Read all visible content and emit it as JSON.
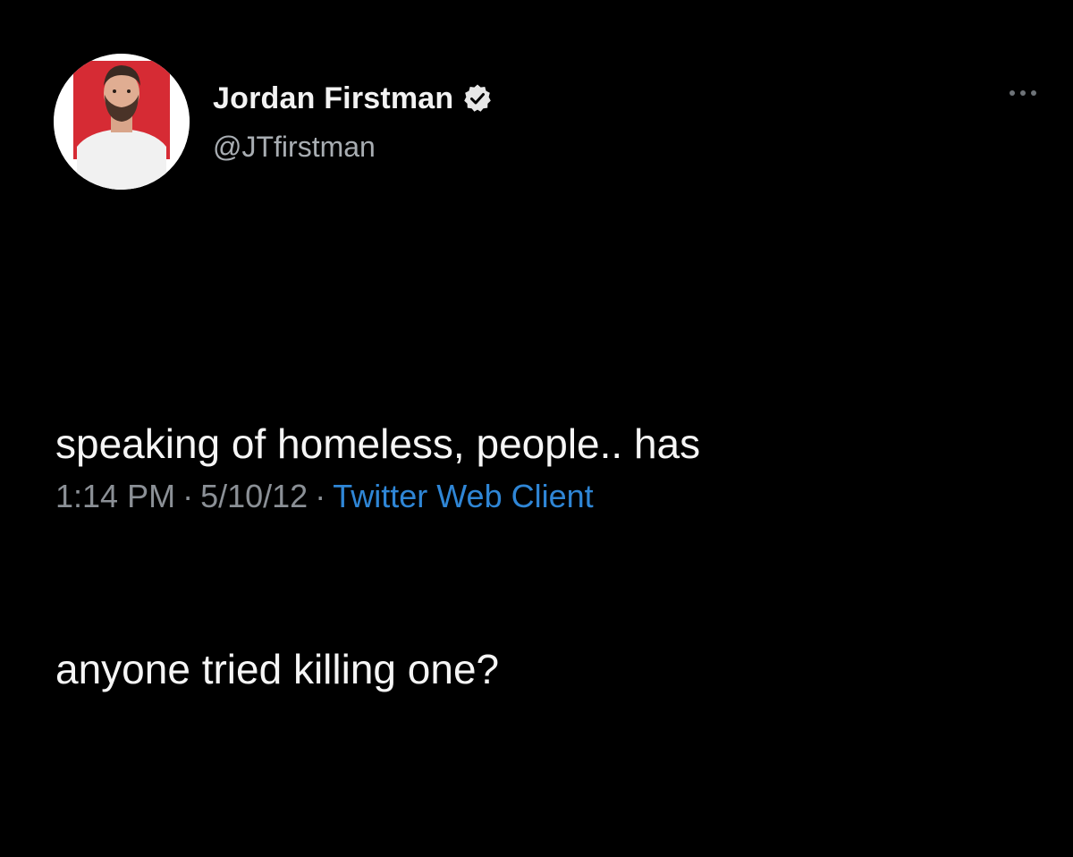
{
  "tweet": {
    "author": {
      "display_name": "Jordan Firstman",
      "handle": "@JTfirstman",
      "verified": true,
      "avatar": "profile-photo"
    },
    "text_lines": [
      "speaking of homeless, people.. has",
      "anyone tried killing one?"
    ],
    "meta": {
      "time": "1:14 PM",
      "separator": "·",
      "date": "5/10/12",
      "source": "Twitter Web Client"
    },
    "menu_icon": "more-horizontal-icon"
  },
  "colors": {
    "background": "#000000",
    "name": "#f2f2f2",
    "handle": "#a8adb2",
    "body_text": "#f5f5f5",
    "meta_text": "#8b9096",
    "link": "#2f86d6",
    "avatar_bg": "#d62b34"
  }
}
